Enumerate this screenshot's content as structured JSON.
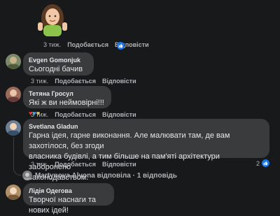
{
  "top": {
    "time": "3 тиж.",
    "like": "Подобається",
    "reply": "Відповісти"
  },
  "comments": [
    {
      "author": "Evgen Gomonjuk",
      "text": "Сьогодні бачив",
      "time": "3 тиж.",
      "like": "Подобається",
      "reply": "Відповісти"
    },
    {
      "author": "Тетяна Гросул",
      "text": "Які ж ви неймовірні!!!",
      "time": "3 тиж.",
      "like": "Подобається",
      "reply": "Відповісти"
    },
    {
      "author": "Svetlana Gladun",
      "text_lines": [
        "Гарна ідея, гарне виконання. Але малювати там, де вам захотілося, без згоди",
        "власника будівлі, а тим більше на пам'яті архітектури заборонено",
        "законодавством."
      ],
      "time": "3 тиж.",
      "like": "Подобається",
      "reply": "Відповісти",
      "reaction_count": "2"
    },
    {
      "author": "Лідія Одегова",
      "text": "Творчої наснаги та нових ідей!"
    }
  ],
  "thread": {
    "replies_text": "Martynova Alyona відповіла · 1 відповідь"
  },
  "colors": {
    "background": "#18191a",
    "bubble": "#3a3b3c",
    "like_blue": "#1b74e4"
  }
}
